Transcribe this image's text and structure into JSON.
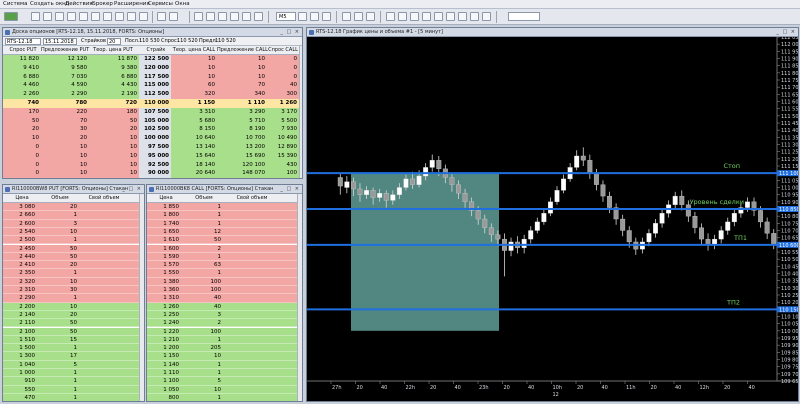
{
  "menu": [
    "Система",
    "Создать окно",
    "Действия",
    "Брокер",
    "Расширения",
    "Сервисы",
    "Окна"
  ],
  "toolbar": {
    "interval": "M5",
    "search_placeholder": ""
  },
  "desk": {
    "title": "Доска опционов [RTS-12.18, 15.11.2018, FORTS: Опционы]",
    "filters": {
      "instrument": "RTS-12.18",
      "date": "15.11.2018",
      "strikes_label": "Страйков",
      "strikes": "20",
      "last_label": "Посл.:",
      "last": "110 530",
      "bid_label": "Спрос:",
      "bid": "110 520",
      "ask_label": "Предл.:",
      "ask": "110 520"
    },
    "headers": [
      "Спрос PUT",
      "Предложение PUT",
      "Теор. цена PUT",
      "Страйк",
      "Теор. цена CALL",
      "Предложение CALL",
      "Спрос CALL"
    ],
    "rows": [
      [
        "11 820",
        "12 120",
        "11 870",
        "122 500",
        "10",
        "10",
        "0"
      ],
      [
        "9 410",
        "9 580",
        "9 380",
        "120 000",
        "10",
        "10",
        "0"
      ],
      [
        "6 880",
        "7 030",
        "6 880",
        "117 500",
        "10",
        "10",
        "0"
      ],
      [
        "4 460",
        "4 590",
        "4 430",
        "115 000",
        "60",
        "70",
        "40"
      ],
      [
        "2 260",
        "2 290",
        "2 190",
        "112 500",
        "320",
        "340",
        "300"
      ],
      [
        "740",
        "780",
        "720",
        "110 000",
        "1 150",
        "1 110",
        "1 260"
      ],
      [
        "170",
        "220",
        "180",
        "107 500",
        "3 310",
        "3 290",
        "3 170"
      ],
      [
        "50",
        "70",
        "50",
        "105 000",
        "5 680",
        "5 710",
        "5 500"
      ],
      [
        "20",
        "30",
        "20",
        "102 500",
        "8 150",
        "8 190",
        "7 930"
      ],
      [
        "10",
        "20",
        "10",
        "100 000",
        "10 640",
        "10 700",
        "10 490"
      ],
      [
        "0",
        "10",
        "10",
        "97 500",
        "13 140",
        "13 200",
        "12 890"
      ],
      [
        "0",
        "10",
        "10",
        "95 000",
        "15 640",
        "15 690",
        "15 390"
      ],
      [
        "0",
        "10",
        "10",
        "92 500",
        "18 140",
        "120 100",
        "430"
      ],
      [
        "0",
        "10",
        "10",
        "90 000",
        "20 640",
        "148 070",
        "100"
      ]
    ]
  },
  "book_put": {
    "title": "RI110000BW8 PUT [FORTS: Опционы] Стакан",
    "headers": [
      "Цена",
      "Объем",
      "Свой объем"
    ],
    "sell": [
      [
        "3 080",
        "20"
      ],
      [
        "2 660",
        "1"
      ],
      [
        "2 600",
        "3"
      ],
      [
        "2 540",
        "10"
      ],
      [
        "2 500",
        "1"
      ],
      [
        "2 450",
        "50"
      ],
      [
        "2 440",
        "50"
      ],
      [
        "2 410",
        "20"
      ],
      [
        "2 350",
        "1"
      ],
      [
        "2 320",
        "10"
      ],
      [
        "2 310",
        "30"
      ],
      [
        "2 290",
        "1"
      ]
    ],
    "buy": [
      [
        "2 200",
        "10"
      ],
      [
        "2 140",
        "20"
      ],
      [
        "2 110",
        "50"
      ],
      [
        "2 100",
        "50"
      ],
      [
        "1 510",
        "15"
      ],
      [
        "1 500",
        "1"
      ],
      [
        "1 300",
        "17"
      ],
      [
        "1 040",
        "5"
      ],
      [
        "1 000",
        "1"
      ],
      [
        "910",
        "1"
      ],
      [
        "550",
        "1"
      ],
      [
        "470",
        "1"
      ]
    ]
  },
  "book_call": {
    "title": "RI110000BK8 CALL [FORTS: Опционы] Стакан",
    "headers": [
      "Цена",
      "Объем",
      "Свой объем"
    ],
    "sell": [
      [
        "1 850",
        "1"
      ],
      [
        "1 800",
        "1"
      ],
      [
        "1 740",
        "1"
      ],
      [
        "1 650",
        "12"
      ],
      [
        "1 610",
        "50"
      ],
      [
        "1 600",
        "2"
      ],
      [
        "1 590",
        "1"
      ],
      [
        "1 570",
        "63"
      ],
      [
        "1 550",
        "1"
      ],
      [
        "1 380",
        "100"
      ],
      [
        "1 360",
        "100"
      ],
      [
        "1 310",
        "40"
      ]
    ],
    "buy": [
      [
        "1 260",
        "40"
      ],
      [
        "1 250",
        "3"
      ],
      [
        "1 240",
        "2"
      ],
      [
        "1 220",
        "100"
      ],
      [
        "1 210",
        "1"
      ],
      [
        "1 200",
        "205"
      ],
      [
        "1 150",
        "10"
      ],
      [
        "1 140",
        "1"
      ],
      [
        "1 110",
        "1"
      ],
      [
        "1 100",
        "5"
      ],
      [
        "1 050",
        "10"
      ],
      [
        "800",
        "1"
      ]
    ]
  },
  "chart": {
    "title": "RTS-12.18 График цены и объема #1 - [5 минут]",
    "y_ticks": [
      "112 050",
      "112 000",
      "111 950",
      "111 900",
      "111 850",
      "111 800",
      "111 750",
      "111 700",
      "111 650",
      "111 600",
      "111 550",
      "111 500",
      "111 450",
      "111 400",
      "111 350",
      "111 300",
      "111 250",
      "111 200",
      "111 150",
      "111 100",
      "111 050",
      "111 000",
      "110 950",
      "110 900",
      "110 850",
      "110 800",
      "110 750",
      "110 700",
      "110 650",
      "110 600",
      "110 550",
      "110 500",
      "110 450",
      "110 400",
      "110 350",
      "110 300",
      "110 250",
      "110 200",
      "110 150",
      "110 100",
      "110 050",
      "110 000",
      "109 950",
      "109 900",
      "109 850",
      "109 800",
      "109 750",
      "109 700",
      "109 650"
    ],
    "x_ticks": [
      "27h",
      "20",
      "40",
      "22h",
      "20",
      "40",
      "23h",
      "20",
      "40",
      "10h",
      "20",
      "40",
      "11h",
      "20",
      "40",
      "12h",
      "20",
      "40"
    ],
    "x_sub": "12",
    "levels": [
      {
        "label": "Стоп",
        "tag": "111 100"
      },
      {
        "label": "Уровень сделки",
        "tag": "110 850"
      },
      {
        "label": "ТП1",
        "tag": "110 600"
      },
      {
        "label": "ТП2",
        "tag": "110 150"
      }
    ],
    "colors": {
      "level": "#1f6fe0",
      "label": "#6fd35f",
      "zone": "#5f9f96",
      "candle": "#d6d6d6"
    }
  }
}
